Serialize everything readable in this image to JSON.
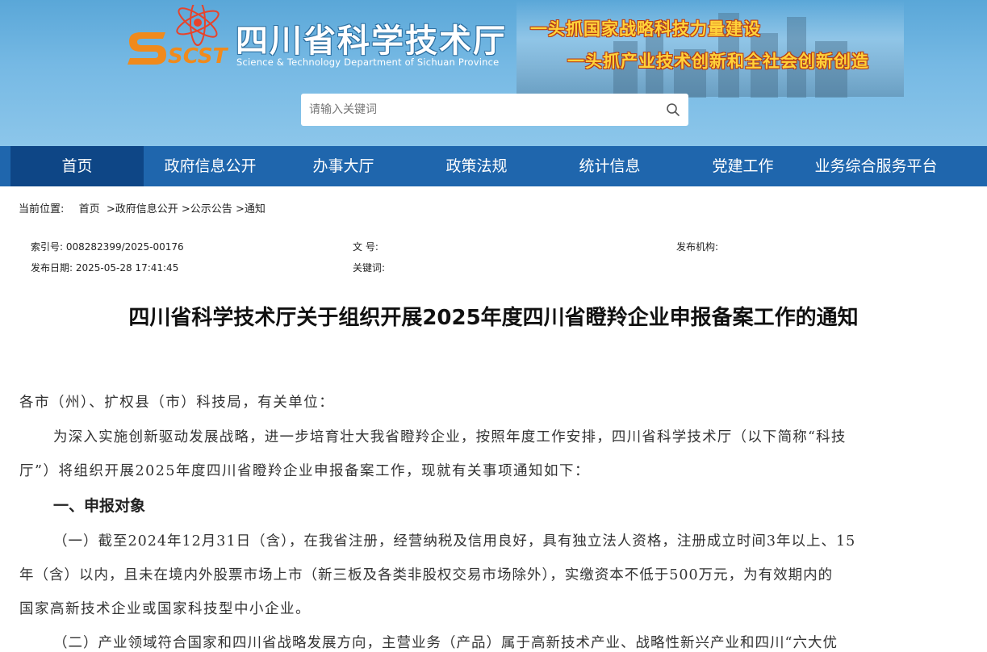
{
  "header": {
    "logo_text": "SCST",
    "site_name": "四川省科学技术厅",
    "site_name_en": "Science & Technology Department of Sichuan Province",
    "slogan_1": "一头抓国家战略科技力量建设",
    "slogan_2": "一头抓产业技术创新和全社会创新创造"
  },
  "search": {
    "placeholder": "请输入关键词",
    "icon": "search-icon"
  },
  "nav": {
    "items": [
      {
        "label": "首页",
        "active": true
      },
      {
        "label": "政府信息公开"
      },
      {
        "label": "办事大厅"
      },
      {
        "label": "政策法规"
      },
      {
        "label": "统计信息"
      },
      {
        "label": "党建工作"
      },
      {
        "label": "业务综合服务平台"
      }
    ]
  },
  "breadcrumb": {
    "prefix": "当前位置:",
    "items": [
      "首页",
      "政府信息公开",
      "公示公告",
      "通知"
    ],
    "sep": ">"
  },
  "meta": {
    "index_label": "索引号:",
    "index_value": "008282399/2025-00176",
    "doc_no_label": "文 号:",
    "doc_no_value": "",
    "publisher_label": "发布机构:",
    "publisher_value": "",
    "date_label": "发布日期:",
    "date_value": "2025-05-28 17:41:45",
    "keywords_label": "关键词:",
    "keywords_value": ""
  },
  "article": {
    "title": "四川省科学技术厅关于组织开展2025年度四川省瞪羚企业申报备案工作的通知",
    "salutation": "各市（州）、扩权县（市）科技局，有关单位：",
    "p1_line1": "为深入实施创新驱动发展战略，进一步培育壮大我省瞪羚企业，按照年度工作安排，四川省科学技术厅（以下简称“科技",
    "p1_line2": "厅”）将组织开展2025年度四川省瞪羚企业申报备案工作，现就有关事项通知如下：",
    "section1": "一、申报对象",
    "p2_line1": "（一）截至2024年12月31日（含），在我省注册，经营纳税及信用良好，具有独立法人资格，注册成立时间3年以上、15",
    "p2_line2": "年（含）以内，且未在境内外股票市场上市（新三板及各类非股权交易市场除外），实缴资本不低于500万元，为有效期内的",
    "p2_line3": "国家高新技术企业或国家科技型中小企业。",
    "p3_line1": "（二）产业领域符合国家和四川省战略发展方向，主营业务（产品）属于高新技术产业、战略性新兴产业和四川“六大优"
  },
  "colors": {
    "nav_bg": "#1f66ad",
    "nav_active": "#0e4686",
    "banner": "#6fb3e0",
    "slogan": "#ffd23a"
  }
}
